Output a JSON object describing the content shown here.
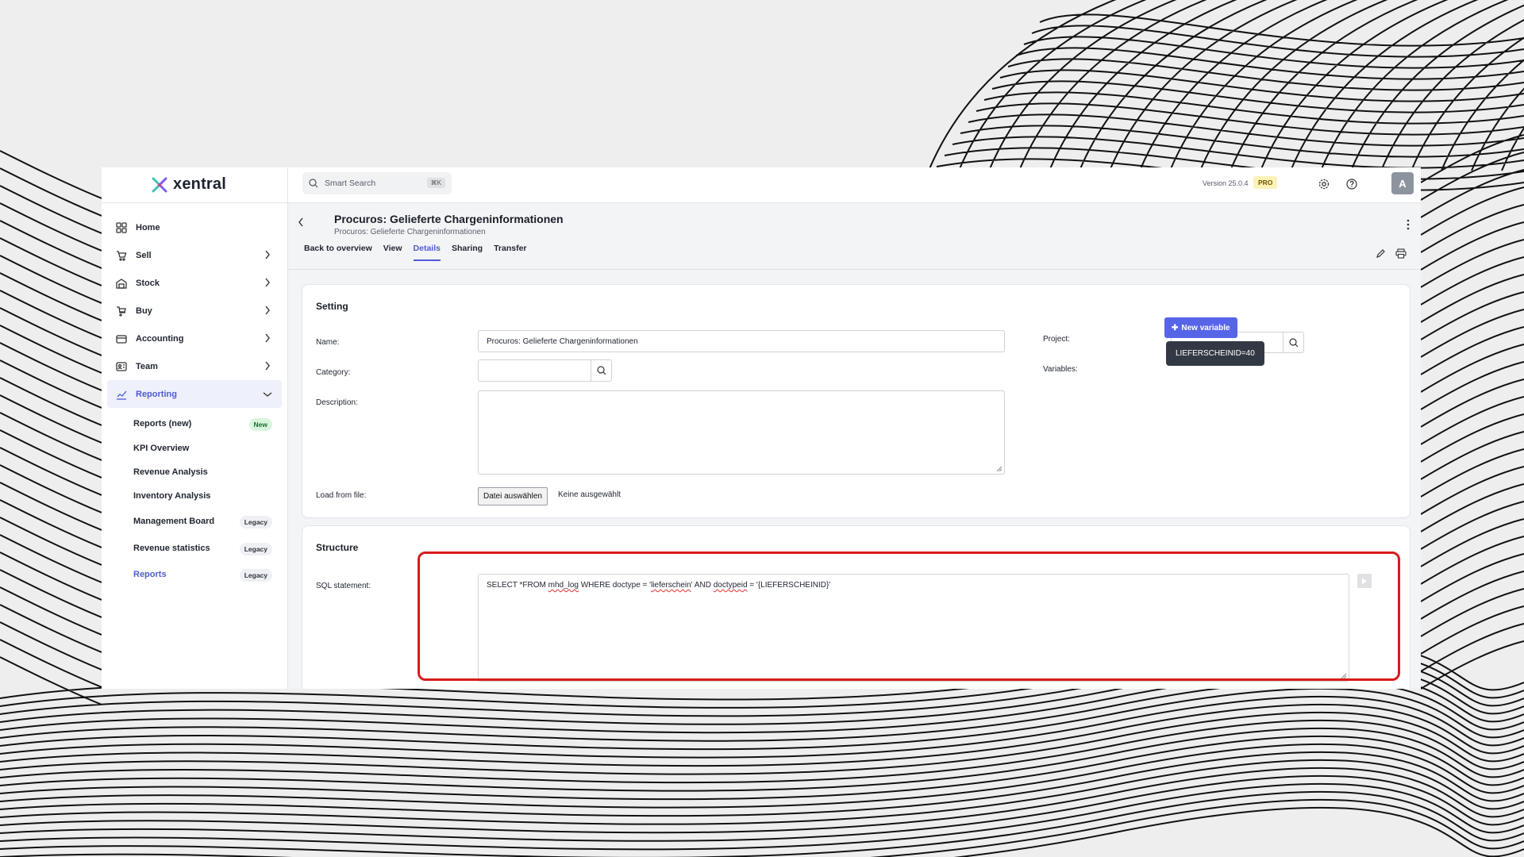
{
  "app": {
    "logo_text": "xentral",
    "search_placeholder": "Smart Search",
    "search_shortcut": "⌘K",
    "version": "Version 25.0.4",
    "plan_badge": "PRO",
    "avatar_initial": "A"
  },
  "sidebar": {
    "items": [
      {
        "label": "Home",
        "icon": "home-grid-icon"
      },
      {
        "label": "Sell",
        "icon": "cart-icon"
      },
      {
        "label": "Stock",
        "icon": "warehouse-icon"
      },
      {
        "label": "Buy",
        "icon": "basket-icon"
      },
      {
        "label": "Accounting",
        "icon": "calculator-icon"
      },
      {
        "label": "Team",
        "icon": "team-icon"
      },
      {
        "label": "Reporting",
        "icon": "chart-icon"
      }
    ],
    "sub_items": [
      {
        "label": "Reports (new)",
        "badge": "New"
      },
      {
        "label": "KPI Overview",
        "badge": ""
      },
      {
        "label": "Revenue Analysis",
        "badge": ""
      },
      {
        "label": "Inventory Analysis",
        "badge": ""
      },
      {
        "label": "Management Board",
        "badge": "Legacy"
      },
      {
        "label": "Revenue statistics",
        "badge": "Legacy"
      },
      {
        "label": "Reports",
        "badge": "Legacy"
      }
    ]
  },
  "page": {
    "title": "Procuros: Gelieferte Chargeninformationen",
    "subtitle": "Procuros: Gelieferte Chargeninformationen",
    "tabs": [
      "Back to overview",
      "View",
      "Details",
      "Sharing",
      "Transfer"
    ],
    "active_tab": "Details"
  },
  "setting": {
    "title": "Setting",
    "name_label": "Name:",
    "name_value": "Procuros: Gelieferte Chargeninformationen",
    "category_label": "Category:",
    "category_value": "",
    "description_label": "Description:",
    "description_value": "",
    "load_file_label": "Load from file:",
    "file_button": "Datei auswählen",
    "file_status": "Keine ausgewählt",
    "project_label": "Project:",
    "project_value": "",
    "variables_label": "Variables:",
    "new_variable_button": "New variable",
    "variable_chip": "LIEFERSCHEINID=40"
  },
  "structure": {
    "title": "Structure",
    "sql_label": "SQL statement:",
    "sql_parts": {
      "p1": "SELECT *FROM ",
      "p2": "mhd_log",
      "p3": " WHERE doctype = '",
      "p4": "lieferschein",
      "p5": "' AND ",
      "p6": "doctypeid",
      "p7": " = '{LIEFERSCHEINID}'"
    }
  },
  "colors": {
    "accent": "#4f5bd5",
    "primary_button": "#5664e8",
    "highlight": "#d91b1b",
    "pro_badge": "#fff2b8"
  }
}
